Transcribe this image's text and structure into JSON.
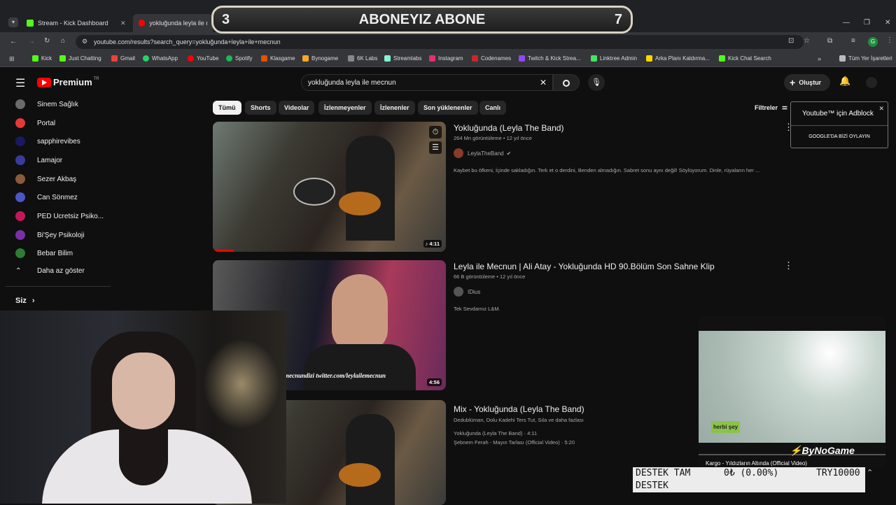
{
  "browser": {
    "tabs": [
      {
        "label": "Stream - Kick Dashboard"
      },
      {
        "label": "yokluğunda leyla ile mecnun"
      }
    ],
    "url": "youtube.com/results?search_query=yokluğunda+leyla+ile+mecnun",
    "bookmarks": [
      "Kick",
      "Just Chatting",
      "Gmail",
      "WhatsApp",
      "YouTube",
      "Spotify",
      "Klasgame",
      "Bynogame",
      "6K Labs",
      "Streamlabs",
      "Instagram",
      "Codenames",
      "Twitch & Kick Strea...",
      "Linktree Admin",
      "Arka Planı Kaldırma...",
      "Kick Chat Search"
    ],
    "all_bookmarks": "Tüm Yer İşaretleri",
    "profile_letter": "G"
  },
  "overlay_top": {
    "left_num": "3",
    "text": "ABONEYIZ ABONE",
    "right_num": "7"
  },
  "youtube": {
    "logo": "Premium",
    "logo_country": "TR",
    "search_value": "yokluğunda leyla ile mecnun",
    "create_label": "Oluştur",
    "sidebar": [
      {
        "label": "Sinem Sağlık",
        "color": "#6b6b6b"
      },
      {
        "label": "Portal",
        "color": "#e53935"
      },
      {
        "label": "sapphirevibes",
        "color": "#1a1a60"
      },
      {
        "label": "Lamajor",
        "color": "#3b3b9a"
      },
      {
        "label": "Sezer Akbaş",
        "color": "#8a5a3a"
      },
      {
        "label": "Can Sönmez",
        "color": "#4a56c8"
      },
      {
        "label": "PED Ucretsiz Psiko...",
        "color": "#c2185b"
      },
      {
        "label": "Bi'Şey Psikoloji",
        "color": "#7a2fa8"
      },
      {
        "label": "Bebar Bilim",
        "color": "#2e7d32"
      }
    ],
    "show_less": "Daha az göster",
    "you": "Siz",
    "chips": [
      "Tümü",
      "Shorts",
      "Videolar",
      "İzlenmeyenler",
      "İzlenenler",
      "Son yüklenenler",
      "Canlı"
    ],
    "filters": "Filtreler",
    "results": [
      {
        "title": "Yokluğunda (Leyla The Band)",
        "meta": "264 Mn görüntüleme • 12 yıl önce",
        "channel": "LeylaTheBand",
        "desc": "Kaybet bu öfkeni, İçinde sakladığın. Terk et o derdini, Benden almadığın. Sabret sonu aynı değil! Söylüyorum. Dinle, rüyaların her ...",
        "duration": "4:11"
      },
      {
        "title": "Leyla ile Mecnun | Ali Atay - Yokluğunda HD 90.Bölüm Son Sahne Klip",
        "meta": "66 B görüntüleme • 12 yıl önce",
        "channel": "IDius",
        "desc": "Tek Sevdamız L&M.",
        "duration": "4:56",
        "watermark": "mecnundizi twitter.com/leylailemecnun"
      },
      {
        "title": "Mix - Yokluğunda (Leyla The Band)",
        "meta": "Dedublüman, Dolu Kadehi Ters Tut, Sıla ve daha fazlası",
        "line1": "Yokluğunda (Leyla The Band) · 4:11",
        "line2": "Şebnem Ferah - Mayın Tarlası (Official Video) · 5:20"
      }
    ]
  },
  "adblock": {
    "title": "Youtube™ için Adblock",
    "button": "GOOGLE'DA BİZİ OYLAYIN"
  },
  "mini_video": {
    "logo": "herbi şey",
    "brand": "ByNoGame",
    "caption": "Kargo - Yıldızların Altında (Official Video)"
  },
  "donation": {
    "label1": "DESTEK TAM",
    "amount": "0₺ (0.00%)",
    "goal": "TRY10000",
    "label2": "DESTEK"
  }
}
